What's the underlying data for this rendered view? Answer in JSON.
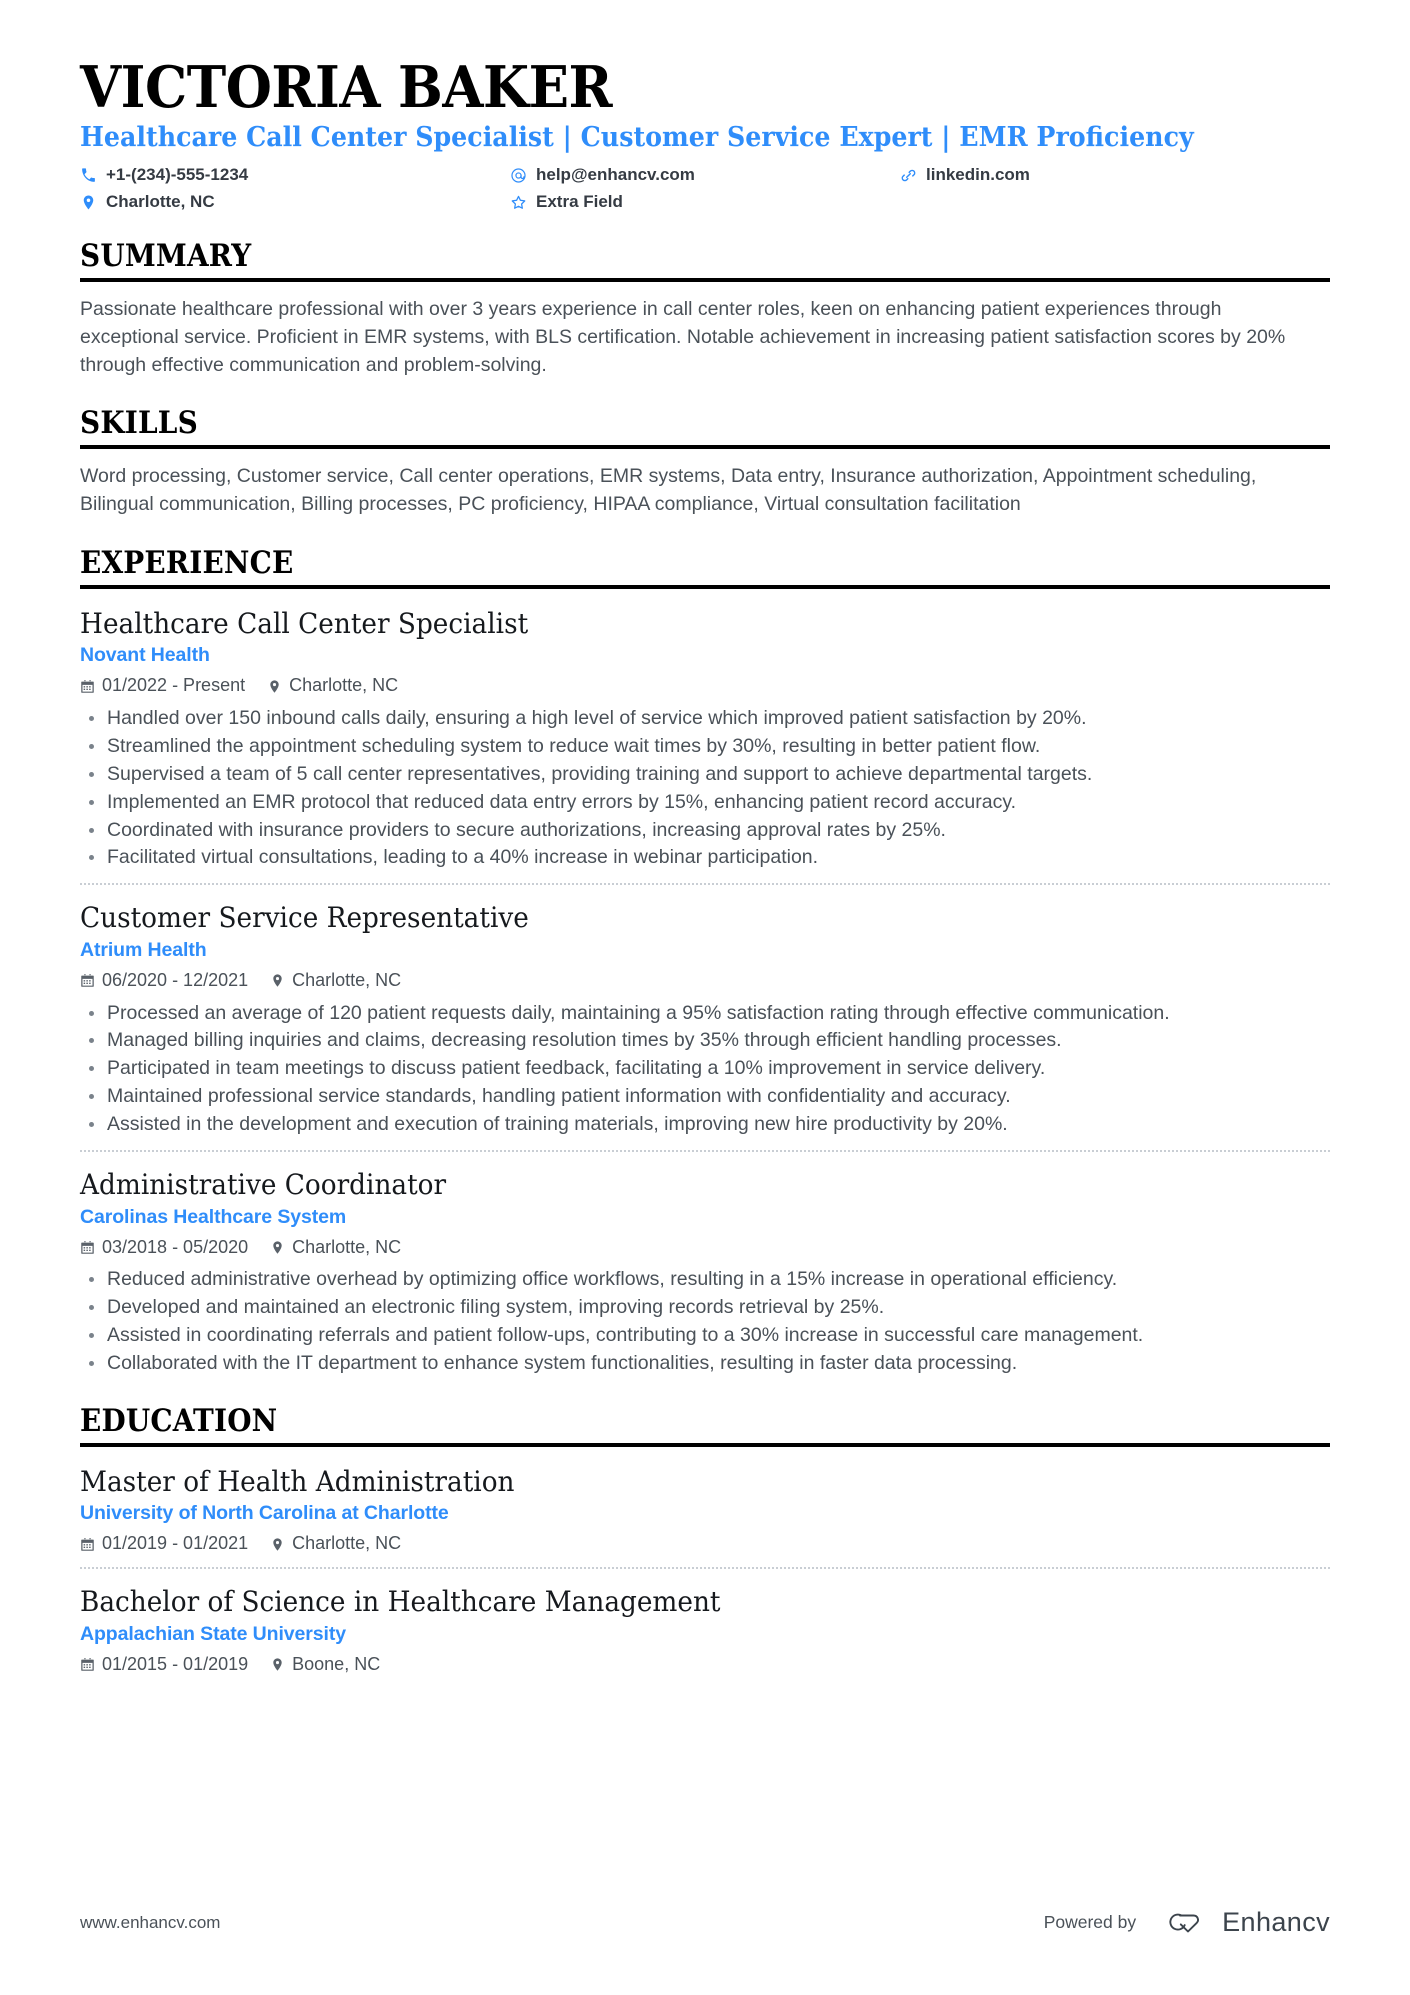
{
  "colors": {
    "accent": "#2f8dfa",
    "text": "#4a5158",
    "heading": "#000000",
    "rule": "#000000",
    "divider": "#c9ced4"
  },
  "header": {
    "name": "VICTORIA BAKER",
    "headline": "Healthcare Call Center Specialist | Customer Service Expert | EMR Proficiency",
    "contacts": [
      {
        "icon": "phone-icon",
        "value": "+1-(234)-555-1234"
      },
      {
        "icon": "email-icon",
        "value": "help@enhancv.com"
      },
      {
        "icon": "link-icon",
        "value": "linkedin.com"
      },
      {
        "icon": "location-icon",
        "value": "Charlotte, NC"
      },
      {
        "icon": "star-icon",
        "value": "Extra Field"
      }
    ]
  },
  "sections": {
    "summary": {
      "title": "SUMMARY",
      "text": "Passionate healthcare professional with over 3 years experience in call center roles, keen on enhancing patient experiences through exceptional service. Proficient in EMR systems, with BLS certification. Notable achievement in increasing patient satisfaction scores by 20% through effective communication and problem-solving."
    },
    "skills": {
      "title": "SKILLS",
      "text": "Word processing, Customer service, Call center operations, EMR systems, Data entry, Insurance authorization, Appointment scheduling, Bilingual communication, Billing processes, PC proficiency, HIPAA compliance, Virtual consultation facilitation"
    },
    "experience": {
      "title": "EXPERIENCE",
      "entries": [
        {
          "title": "Healthcare Call Center Specialist",
          "org": "Novant Health",
          "dates": "01/2022 - Present",
          "location": "Charlotte, NC",
          "bullets": [
            "Handled over 150 inbound calls daily, ensuring a high level of service which improved patient satisfaction by 20%.",
            "Streamlined the appointment scheduling system to reduce wait times by 30%, resulting in better patient flow.",
            "Supervised a team of 5 call center representatives, providing training and support to achieve departmental targets.",
            "Implemented an EMR protocol that reduced data entry errors by 15%, enhancing patient record accuracy.",
            "Coordinated with insurance providers to secure authorizations, increasing approval rates by 25%.",
            "Facilitated virtual consultations, leading to a 40% increase in webinar participation."
          ]
        },
        {
          "title": "Customer Service Representative",
          "org": "Atrium Health",
          "dates": "06/2020 - 12/2021",
          "location": "Charlotte, NC",
          "bullets": [
            "Processed an average of 120 patient requests daily, maintaining a 95% satisfaction rating through effective communication.",
            "Managed billing inquiries and claims, decreasing resolution times by 35% through efficient handling processes.",
            "Participated in team meetings to discuss patient feedback, facilitating a 10% improvement in service delivery.",
            "Maintained professional service standards, handling patient information with confidentiality and accuracy.",
            "Assisted in the development and execution of training materials, improving new hire productivity by 20%."
          ]
        },
        {
          "title": "Administrative Coordinator",
          "org": "Carolinas Healthcare System",
          "dates": "03/2018 - 05/2020",
          "location": "Charlotte, NC",
          "bullets": [
            "Reduced administrative overhead by optimizing office workflows, resulting in a 15% increase in operational efficiency.",
            "Developed and maintained an electronic filing system, improving records retrieval by 25%.",
            "Assisted in coordinating referrals and patient follow-ups, contributing to a 30% increase in successful care management.",
            "Collaborated with the IT department to enhance system functionalities, resulting in faster data processing."
          ]
        }
      ]
    },
    "education": {
      "title": "EDUCATION",
      "entries": [
        {
          "title": "Master of Health Administration",
          "org": "University of North Carolina at Charlotte",
          "dates": "01/2019 - 01/2021",
          "location": "Charlotte, NC"
        },
        {
          "title": "Bachelor of Science in Healthcare Management",
          "org": "Appalachian State University",
          "dates": "01/2015 - 01/2019",
          "location": "Boone, NC"
        }
      ]
    }
  },
  "footer": {
    "url": "www.enhancv.com",
    "powered_label": "Powered by",
    "brand": "Enhancv"
  }
}
